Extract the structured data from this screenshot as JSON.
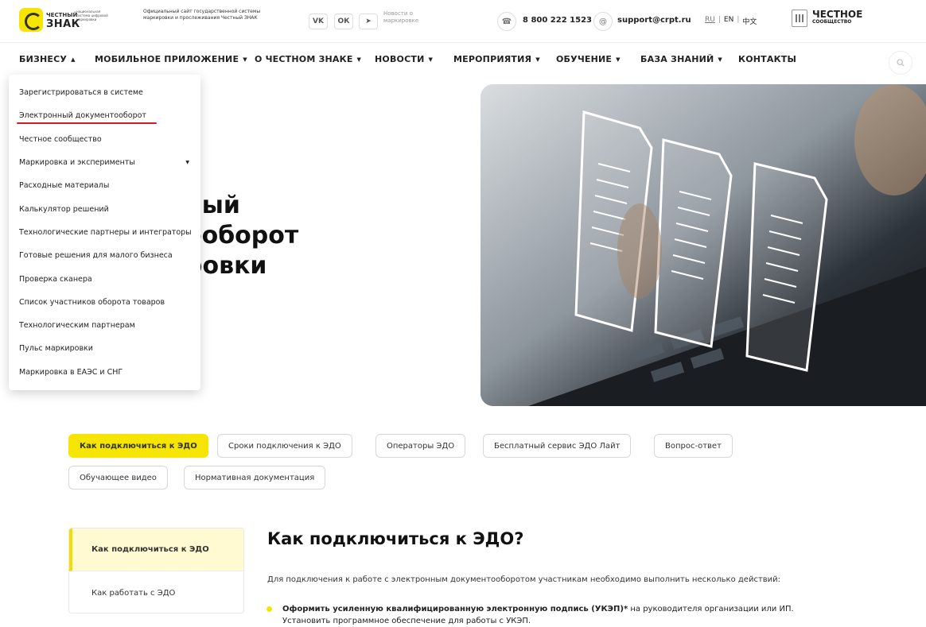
{
  "header": {
    "logo": {
      "small": "ЧЕСТНЫЙ",
      "big": "ЗНАК",
      "sub": "национальная система цифровой маркировки"
    },
    "tagline": "Официальный сайт государственной системы маркировки и прослеживания Честный ЗНАК",
    "social": [
      {
        "name": "vk-icon",
        "label": "VK"
      },
      {
        "name": "odnoklassniki-icon",
        "label": "ОК"
      },
      {
        "name": "telegram-icon",
        "label": "➤"
      }
    ],
    "news_label": "Новости о маркировке",
    "phone": "8 800 222 1523",
    "email": "support@crpt.ru",
    "languages": [
      "RU",
      "EN",
      "中文"
    ],
    "community": {
      "title": "ЧЕСТНОЕ",
      "subtitle": "СООБЩЕСТВО"
    }
  },
  "nav": {
    "items": [
      "БИЗНЕСУ",
      "МОБИЛЬНОЕ ПРИЛОЖЕНИЕ",
      "О ЧЕСТНОМ ЗНАКЕ",
      "НОВОСТИ",
      "МЕРОПРИЯТИЯ",
      "ОБУЧЕНИЕ",
      "БАЗА ЗНАНИЙ",
      "КОНТАКТЫ"
    ]
  },
  "menu": {
    "items": [
      "Зарегистрироваться в системе",
      "Электронный документооборот",
      "Честное сообщество",
      "Маркировка и эксперименты",
      "Расходные материалы",
      "Калькулятор решений",
      "Технологические партнеры и интеграторы",
      "Готовые решения для малого бизнеса",
      "Проверка сканера",
      "Список участников оборота товаров",
      "Технологическим партнерам",
      "Пульс маркировки",
      "Маркировка в ЕАЭС и СНГ"
    ]
  },
  "hero": {
    "title_line_1": "ный",
    "title_line_2": "ооборот",
    "title_line_3": "ровки"
  },
  "tabs": [
    "Как подключиться к ЭДО",
    "Сроки подключения к ЭДО",
    "Операторы ЭДО",
    "Бесплатный сервис ЭДО Лайт",
    "Вопрос-ответ",
    "Обучающее видео",
    "Нормативная документация"
  ],
  "sidebar": {
    "items": [
      "Как подключиться к ЭДО",
      "Как работать с ЭДО"
    ]
  },
  "content": {
    "title": "Как подключиться к ЭДО?",
    "intro": "Для подключения к работе с электронным документооборотом участникам необходимо выполнить несколько действий:",
    "bullet_strong": "Оформить усиленную квалифицированную электронную подпись (УКЭП)*",
    "bullet_rest": " на руководителя организации или ИП.",
    "bullet_line_2": "Установить программное обеспечение для работы с УКЭП."
  },
  "colors": {
    "accent": "#f6e500",
    "active_underline": "#cc1d28"
  }
}
